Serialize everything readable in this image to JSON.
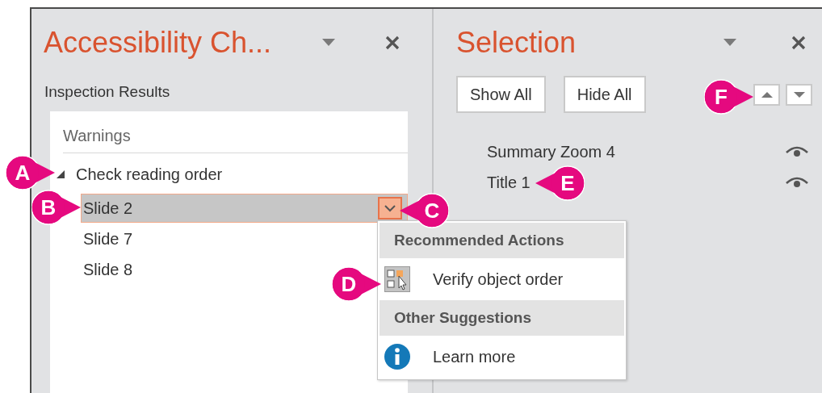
{
  "accessibility_pane": {
    "title": "Accessibility Ch...",
    "section_label": "Inspection Results",
    "results": {
      "heading": "Warnings",
      "groups": [
        {
          "label": "Check reading order",
          "expanded": true,
          "children": [
            {
              "label": "Slide 2",
              "selected": true
            },
            {
              "label": "Slide 7",
              "selected": false
            },
            {
              "label": "Slide 8",
              "selected": false
            }
          ]
        }
      ]
    }
  },
  "context_menu": {
    "sections": [
      {
        "heading": "Recommended Actions",
        "items": [
          {
            "label": "Verify object order",
            "kind": "arrange"
          }
        ]
      },
      {
        "heading": "Other Suggestions",
        "items": [
          {
            "label": "Learn more",
            "kind": "info"
          }
        ]
      }
    ]
  },
  "selection_pane": {
    "title": "Selection",
    "buttons": [
      "Show All",
      "Hide All"
    ],
    "objects": [
      {
        "name": "Summary Zoom 4",
        "visible": true
      },
      {
        "name": "Title 1",
        "visible": true
      }
    ]
  },
  "callouts": [
    {
      "letter": "A"
    },
    {
      "letter": "B"
    },
    {
      "letter": "C"
    },
    {
      "letter": "D"
    },
    {
      "letter": "E"
    },
    {
      "letter": "F"
    }
  ]
}
